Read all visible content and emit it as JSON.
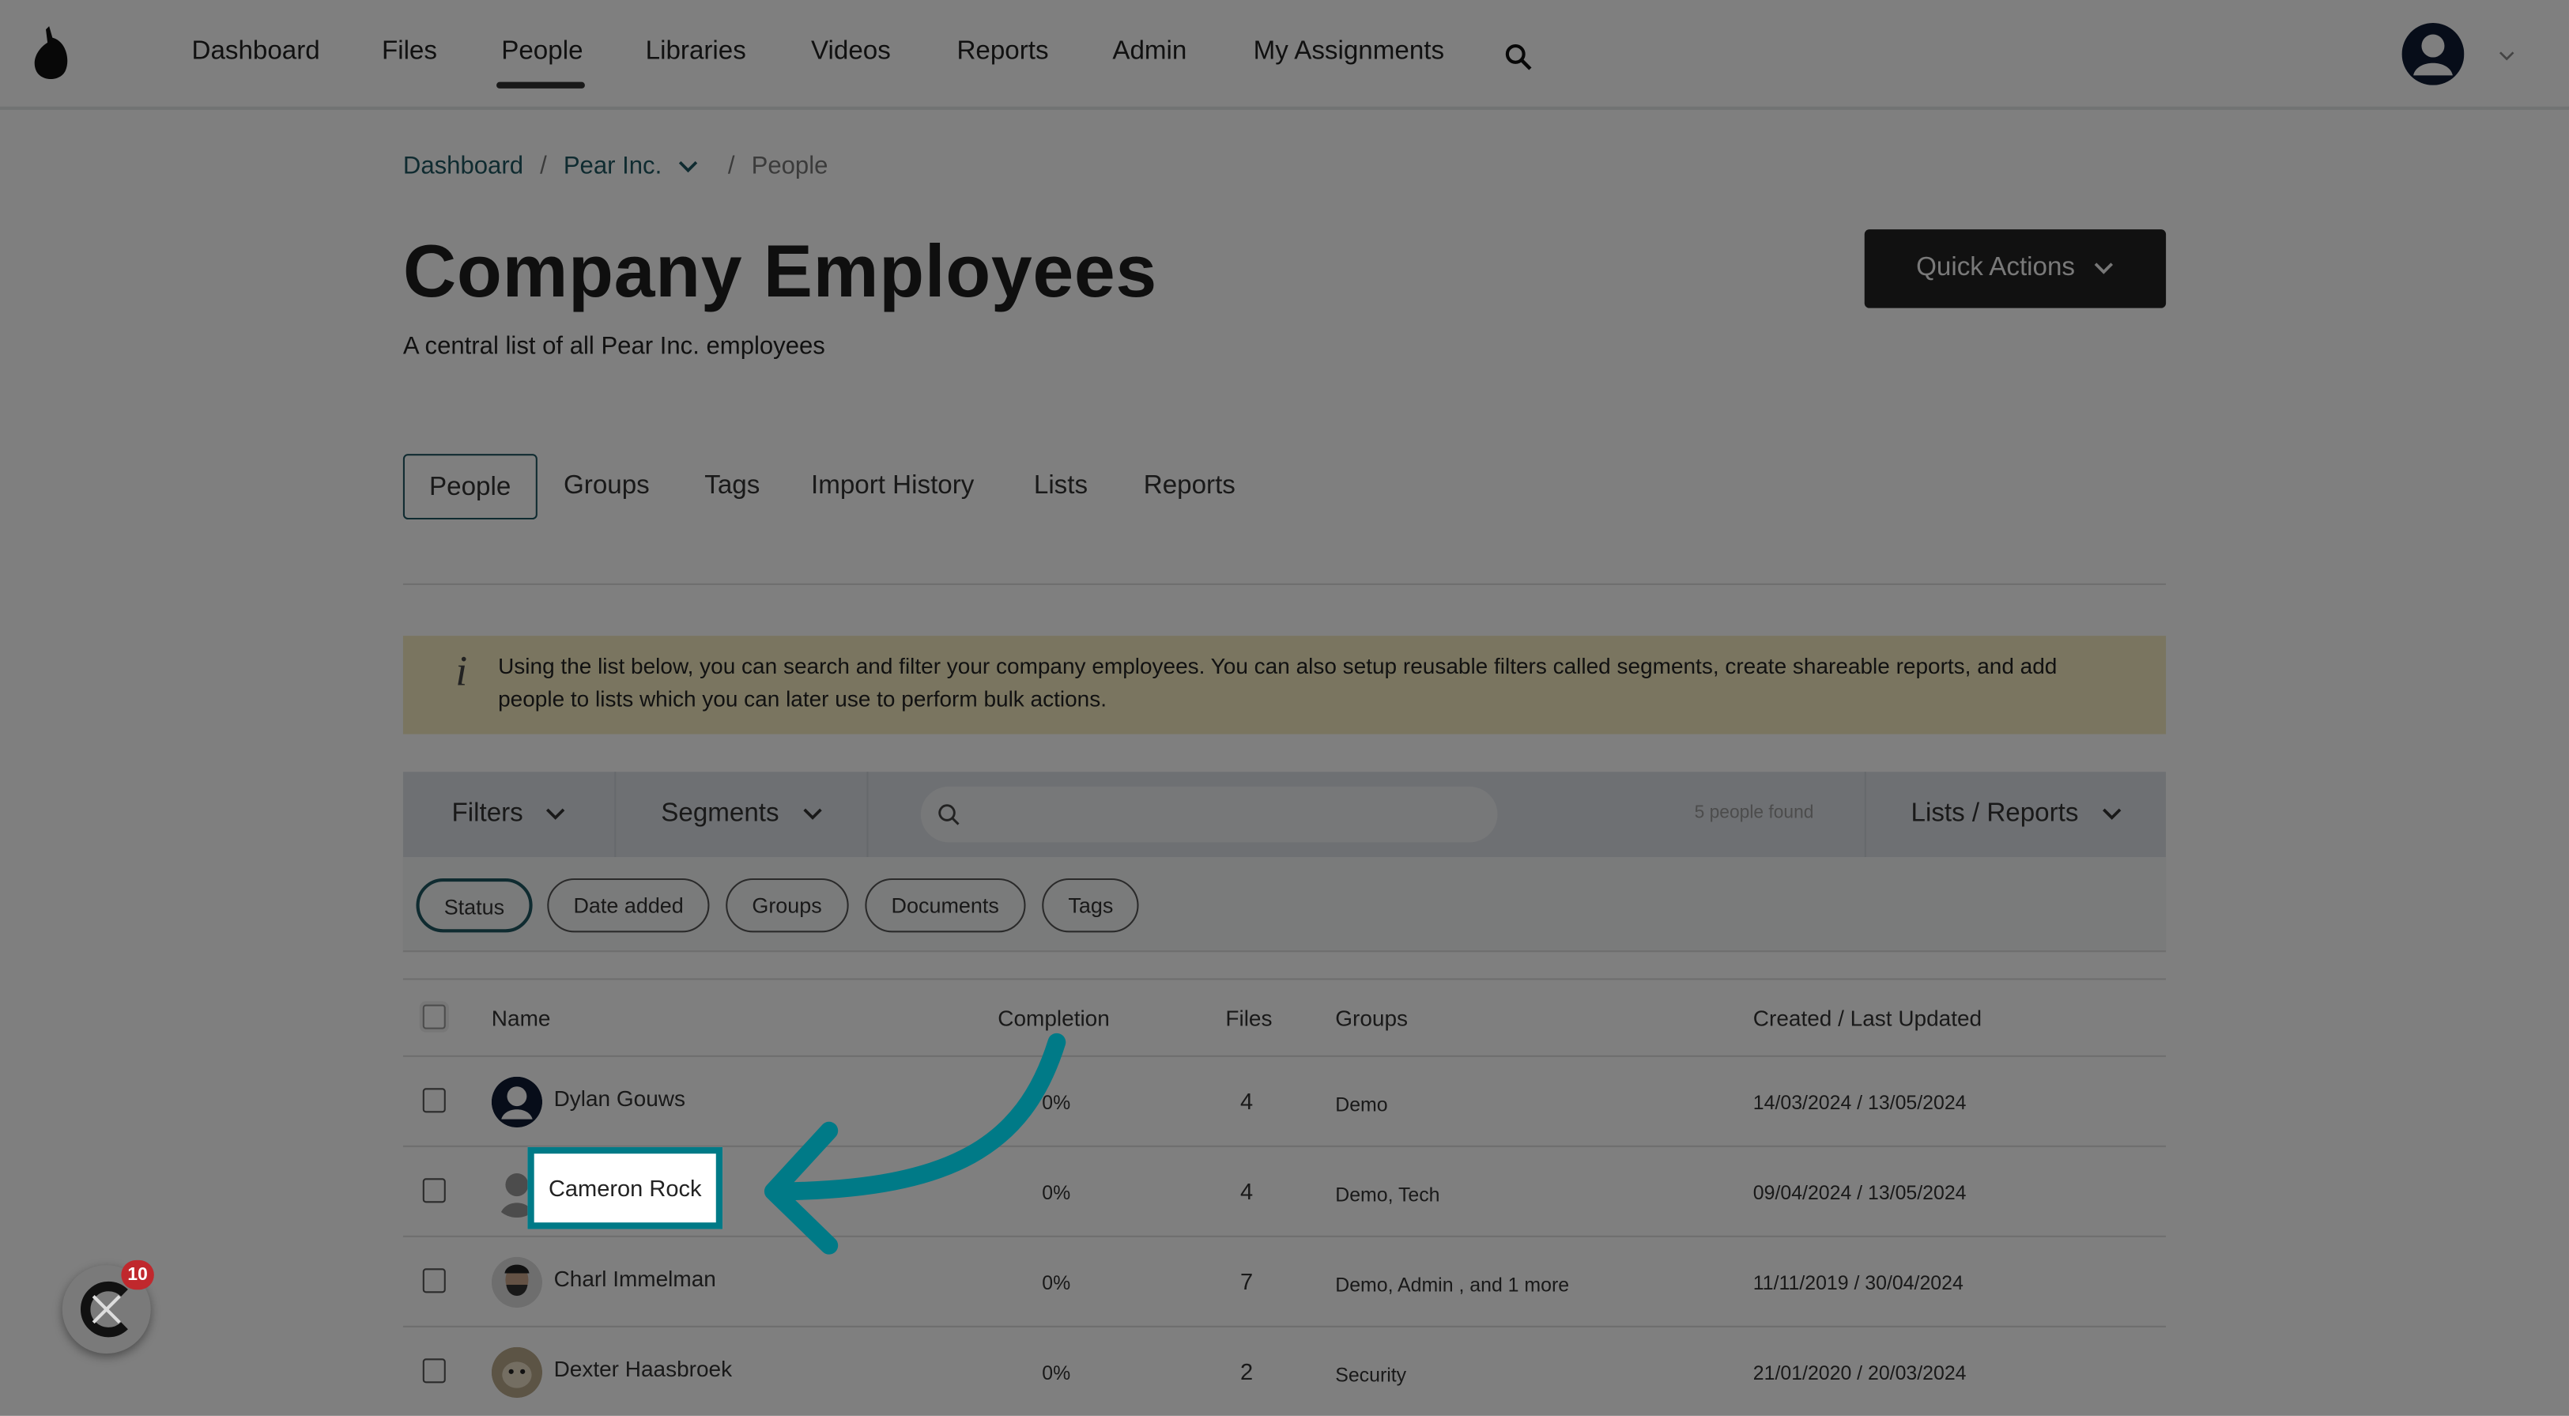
{
  "nav": {
    "items": [
      "Dashboard",
      "Files",
      "People",
      "Libraries",
      "Videos",
      "Reports",
      "Admin",
      "My Assignments"
    ],
    "active": "People"
  },
  "breadcrumb": {
    "items": [
      "Dashboard",
      "Pear Inc.",
      "People"
    ],
    "sep": "/"
  },
  "page": {
    "title": "Company Employees",
    "subtitle": "A central list of all Pear Inc. employees",
    "quick_actions": "Quick Actions"
  },
  "tabs": [
    "People",
    "Groups",
    "Tags",
    "Import History",
    "Lists",
    "Reports"
  ],
  "info": {
    "icon": "i",
    "text": "Using the list below, you can search and filter your company employees. You can also setup reusable filters called segments, create shareable reports, and add people to lists which you can later use to perform bulk actions."
  },
  "toolbar": {
    "filters": "Filters",
    "segments": "Segments",
    "search_placeholder": "",
    "count": "5 people found",
    "lists_reports": "Lists / Reports"
  },
  "chips": [
    "Status",
    "Date added",
    "Groups",
    "Documents",
    "Tags"
  ],
  "table": {
    "headers": [
      "Name",
      "Completion",
      "Files",
      "Groups",
      "Created / Last Updated"
    ],
    "rows": [
      {
        "name": "Dylan Gouws",
        "completion": "0%",
        "files": "4",
        "groups": "Demo",
        "dates": "14/03/2024 / 13/05/2024"
      },
      {
        "name": "Cameron Rock",
        "completion": "0%",
        "files": "4",
        "groups": "Demo, Tech",
        "dates": "09/04/2024 / 13/05/2024"
      },
      {
        "name": "Charl Immelman",
        "completion": "0%",
        "files": "7",
        "groups": "Demo, Admin , and 1 more",
        "dates": "11/11/2019 / 30/04/2024"
      },
      {
        "name": "Dexter Haasbroek",
        "completion": "0%",
        "files": "2",
        "groups": "Security",
        "dates": "21/01/2020 / 20/03/2024"
      }
    ]
  },
  "highlight": {
    "label": "Cameron Rock"
  },
  "widget": {
    "badge": "10"
  },
  "colors": {
    "accent": "#007a87",
    "link": "#1f5661",
    "info_bg": "#f4ebc1",
    "overlay": "rgba(0,0,0,0.5)"
  }
}
